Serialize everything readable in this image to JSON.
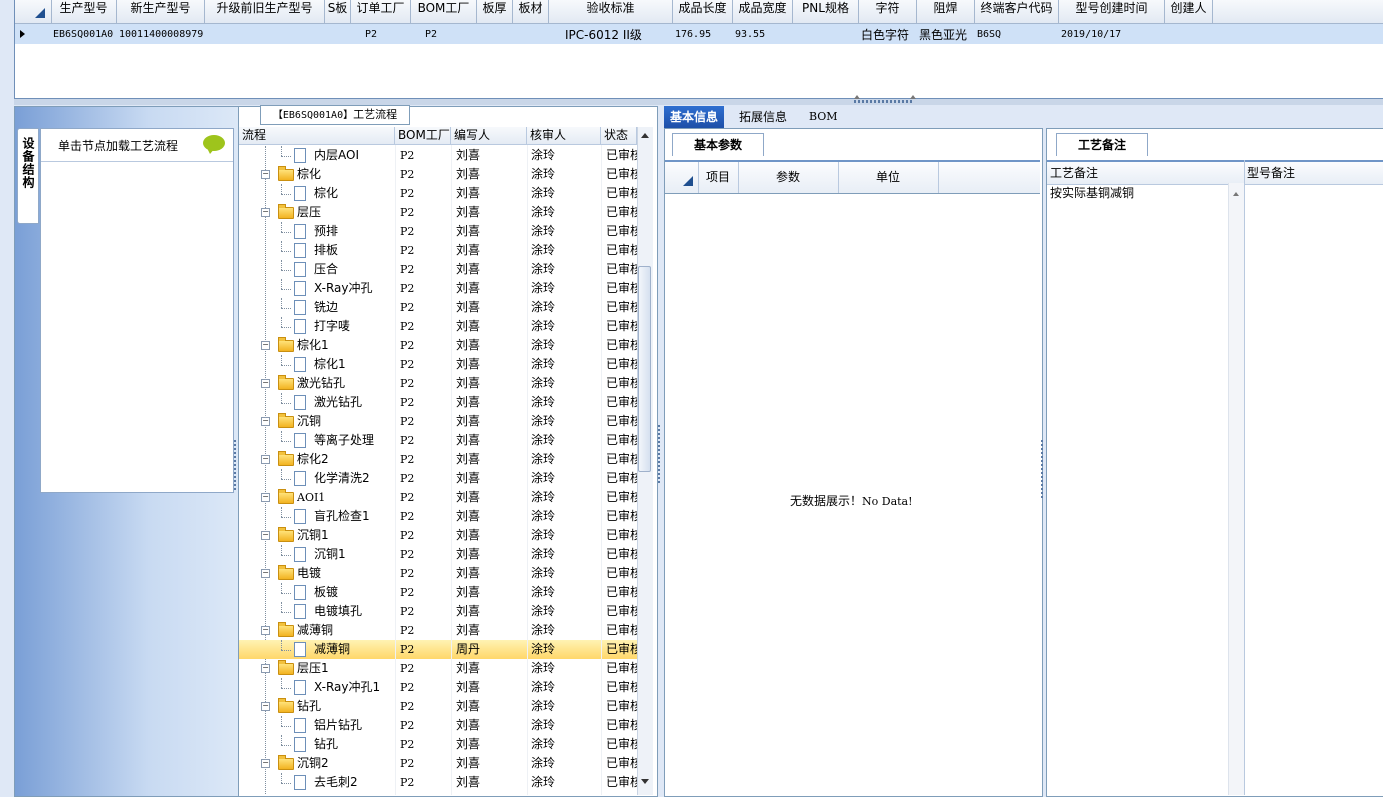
{
  "top_grid": {
    "columns": [
      "生产型号",
      "新生产型号",
      "升级前旧生产型号",
      "S板",
      "订单工厂",
      "BOM工厂",
      "板厚",
      "板材",
      "验收标准",
      "成品长度",
      "成品宽度",
      "PNL规格",
      "字符",
      "阻焊",
      "终端客户代码",
      "型号创建时间",
      "创建人"
    ],
    "row": [
      "EB6SQ001A0",
      "10011400008979",
      "",
      "",
      "P2",
      "P2",
      "",
      "",
      "IPC-6012 II级",
      "176.95",
      "93.55",
      "",
      "白色字符",
      "黑色亚光",
      "B6SQ",
      "2019/10/17",
      ""
    ]
  },
  "side_tab_label": "设备结构",
  "node_panel": {
    "hint": "单击节点加载工艺流程"
  },
  "flow_title": {
    "code": "【EB6SQ001A0】",
    "label": "工艺流程"
  },
  "flow_grid": {
    "columns": [
      "流程",
      "BOM工厂",
      "编写人",
      "核审人",
      "状态"
    ],
    "rows": [
      {
        "level": 2,
        "name": "内层AOI",
        "factory": "P2",
        "author": "刘喜",
        "reviewer": "涂玲",
        "status": "已审核"
      },
      {
        "level": 1,
        "name": "棕化",
        "factory": "P2",
        "author": "刘喜",
        "reviewer": "涂玲",
        "status": "已审核"
      },
      {
        "level": 2,
        "name": "棕化",
        "factory": "P2",
        "author": "刘喜",
        "reviewer": "涂玲",
        "status": "已审核"
      },
      {
        "level": 1,
        "name": "层压",
        "factory": "P2",
        "author": "刘喜",
        "reviewer": "涂玲",
        "status": "已审核"
      },
      {
        "level": 2,
        "name": "预排",
        "factory": "P2",
        "author": "刘喜",
        "reviewer": "涂玲",
        "status": "已审核"
      },
      {
        "level": 2,
        "name": "排板",
        "factory": "P2",
        "author": "刘喜",
        "reviewer": "涂玲",
        "status": "已审核"
      },
      {
        "level": 2,
        "name": "压合",
        "factory": "P2",
        "author": "刘喜",
        "reviewer": "涂玲",
        "status": "已审核"
      },
      {
        "level": 2,
        "name": "X-Ray冲孔",
        "factory": "P2",
        "author": "刘喜",
        "reviewer": "涂玲",
        "status": "已审核"
      },
      {
        "level": 2,
        "name": "铣边",
        "factory": "P2",
        "author": "刘喜",
        "reviewer": "涂玲",
        "status": "已审核"
      },
      {
        "level": 2,
        "name": "打字唛",
        "factory": "P2",
        "author": "刘喜",
        "reviewer": "涂玲",
        "status": "已审核"
      },
      {
        "level": 1,
        "name": "棕化1",
        "factory": "P2",
        "author": "刘喜",
        "reviewer": "涂玲",
        "status": "已审核"
      },
      {
        "level": 2,
        "name": "棕化1",
        "factory": "P2",
        "author": "刘喜",
        "reviewer": "涂玲",
        "status": "已审核"
      },
      {
        "level": 1,
        "name": "激光钻孔",
        "factory": "P2",
        "author": "刘喜",
        "reviewer": "涂玲",
        "status": "已审核"
      },
      {
        "level": 2,
        "name": "激光钻孔",
        "factory": "P2",
        "author": "刘喜",
        "reviewer": "涂玲",
        "status": "已审核"
      },
      {
        "level": 1,
        "name": "沉铜",
        "factory": "P2",
        "author": "刘喜",
        "reviewer": "涂玲",
        "status": "已审核"
      },
      {
        "level": 2,
        "name": "等离子处理",
        "factory": "P2",
        "author": "刘喜",
        "reviewer": "涂玲",
        "status": "已审核"
      },
      {
        "level": 1,
        "name": "棕化2",
        "factory": "P2",
        "author": "刘喜",
        "reviewer": "涂玲",
        "status": "已审核"
      },
      {
        "level": 2,
        "name": "化学清洗2",
        "factory": "P2",
        "author": "刘喜",
        "reviewer": "涂玲",
        "status": "已审核"
      },
      {
        "level": 1,
        "name": "AOI1",
        "factory": "P2",
        "author": "刘喜",
        "reviewer": "涂玲",
        "status": "已审核"
      },
      {
        "level": 2,
        "name": "盲孔检查1",
        "factory": "P2",
        "author": "刘喜",
        "reviewer": "涂玲",
        "status": "已审核"
      },
      {
        "level": 1,
        "name": "沉铜1",
        "factory": "P2",
        "author": "刘喜",
        "reviewer": "涂玲",
        "status": "已审核"
      },
      {
        "level": 2,
        "name": "沉铜1",
        "factory": "P2",
        "author": "刘喜",
        "reviewer": "涂玲",
        "status": "已审核"
      },
      {
        "level": 1,
        "name": "电镀",
        "factory": "P2",
        "author": "刘喜",
        "reviewer": "涂玲",
        "status": "已审核"
      },
      {
        "level": 2,
        "name": "板镀",
        "factory": "P2",
        "author": "刘喜",
        "reviewer": "涂玲",
        "status": "已审核"
      },
      {
        "level": 2,
        "name": "电镀填孔",
        "factory": "P2",
        "author": "刘喜",
        "reviewer": "涂玲",
        "status": "已审核"
      },
      {
        "level": 1,
        "name": "减薄铜",
        "factory": "P2",
        "author": "刘喜",
        "reviewer": "涂玲",
        "status": "已审核"
      },
      {
        "level": 2,
        "name": "减薄铜",
        "factory": "P2",
        "author": "周丹",
        "reviewer": "涂玲",
        "status": "已审核",
        "selected": true
      },
      {
        "level": 1,
        "name": "层压1",
        "factory": "P2",
        "author": "刘喜",
        "reviewer": "涂玲",
        "status": "已审核"
      },
      {
        "level": 2,
        "name": "X-Ray冲孔1",
        "factory": "P2",
        "author": "刘喜",
        "reviewer": "涂玲",
        "status": "已审核"
      },
      {
        "level": 1,
        "name": "钻孔",
        "factory": "P2",
        "author": "刘喜",
        "reviewer": "涂玲",
        "status": "已审核"
      },
      {
        "level": 2,
        "name": "铝片钻孔",
        "factory": "P2",
        "author": "刘喜",
        "reviewer": "涂玲",
        "status": "已审核"
      },
      {
        "level": 2,
        "name": "钻孔",
        "factory": "P2",
        "author": "刘喜",
        "reviewer": "涂玲",
        "status": "已审核"
      },
      {
        "level": 1,
        "name": "沉铜2",
        "factory": "P2",
        "author": "刘喜",
        "reviewer": "涂玲",
        "status": "已审核"
      },
      {
        "level": 2,
        "name": "去毛刺2",
        "factory": "P2",
        "author": "刘喜",
        "reviewer": "涂玲",
        "status": "已审核"
      }
    ]
  },
  "right_tabs": [
    "基本信息",
    "拓展信息",
    "BOM"
  ],
  "basic_params": {
    "tab": "基本参数",
    "columns": [
      "项目",
      "参数",
      "单位"
    ],
    "empty_text_cn": "无数据展示！",
    "empty_text_en": "No Data!"
  },
  "process_notes": {
    "tab": "工艺备注",
    "columns": [
      "工艺备注",
      "型号备注"
    ],
    "note": "按实际基铜减铜"
  },
  "colors": {
    "accent": "#1d4fa8",
    "selection": "#ffd76a",
    "row_highlight": "#cfe1f7"
  }
}
